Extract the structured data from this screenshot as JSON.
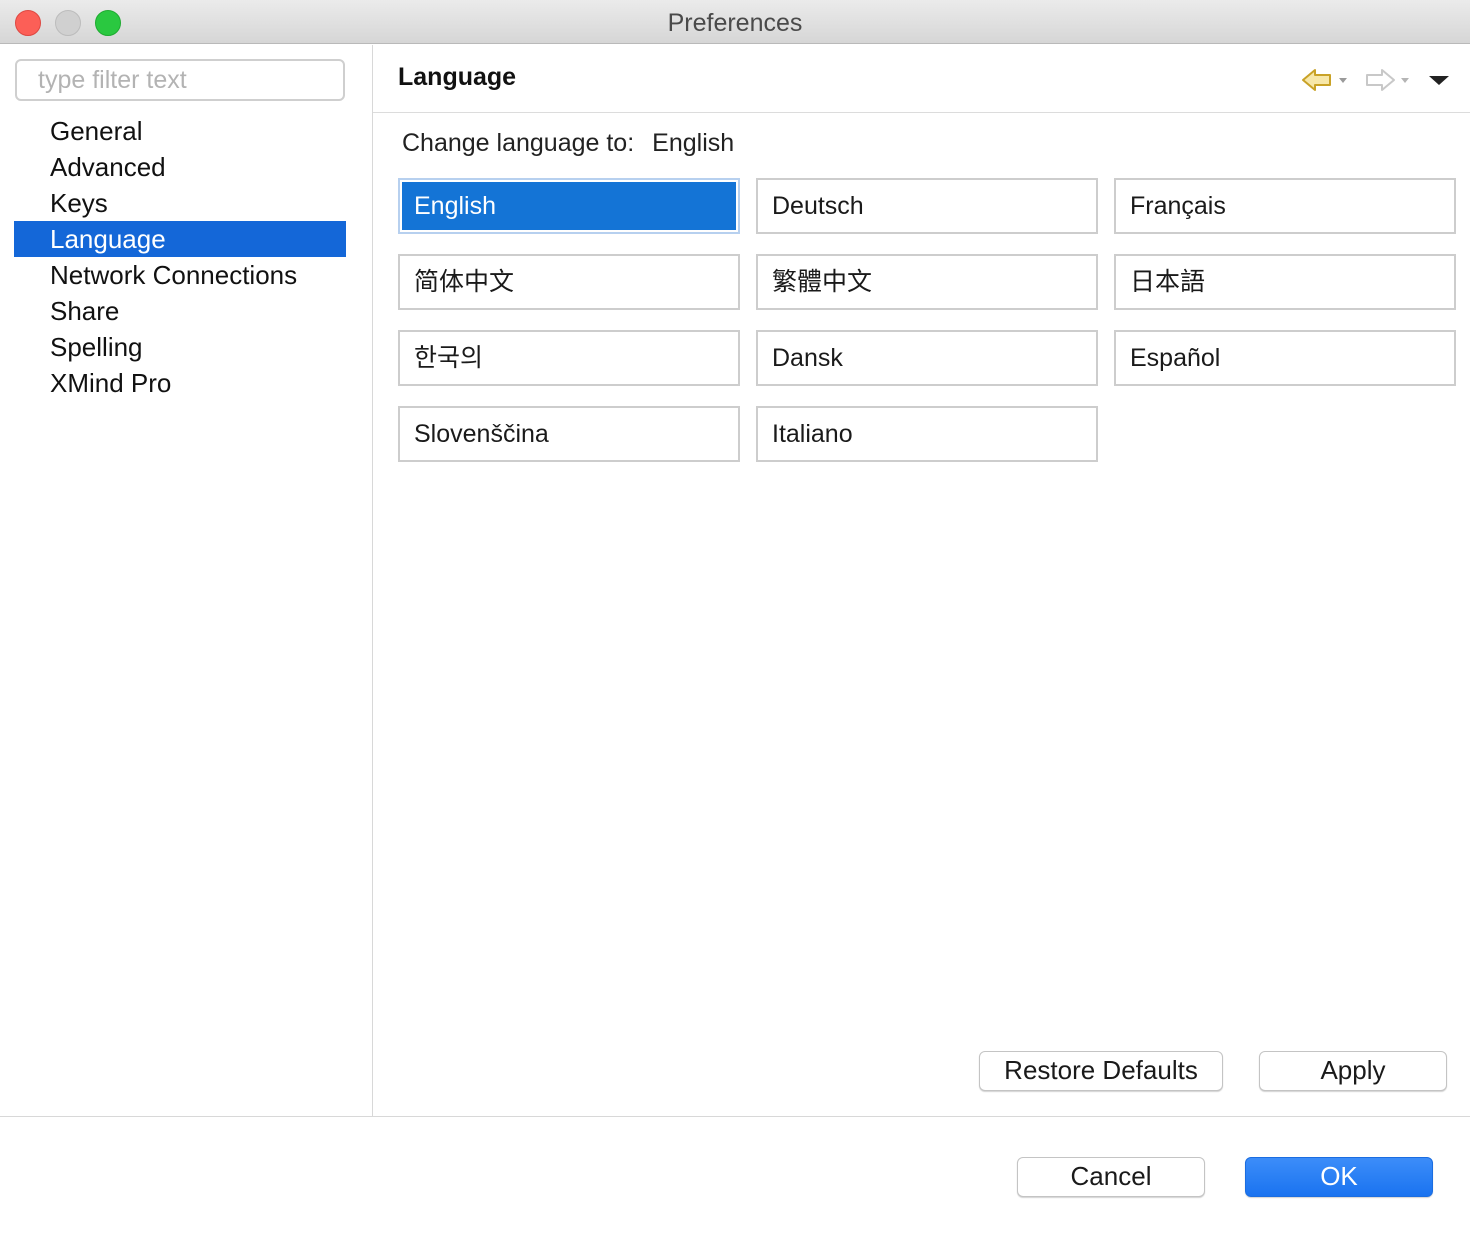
{
  "window": {
    "title": "Preferences"
  },
  "sidebar": {
    "filter_placeholder": "type filter text",
    "items": [
      {
        "label": "General"
      },
      {
        "label": "Advanced"
      },
      {
        "label": "Keys"
      },
      {
        "label": "Language",
        "selected": true
      },
      {
        "label": "Network Connections"
      },
      {
        "label": "Share"
      },
      {
        "label": "Spelling"
      },
      {
        "label": "XMind Pro"
      }
    ]
  },
  "page": {
    "title": "Language",
    "change_label": "Change language to:",
    "current_language": "English",
    "languages": [
      {
        "label": "English",
        "selected": true
      },
      {
        "label": "Deutsch"
      },
      {
        "label": "Français"
      },
      {
        "label": "简体中文"
      },
      {
        "label": "繁體中文"
      },
      {
        "label": "日本語"
      },
      {
        "label": "한국의"
      },
      {
        "label": "Dansk"
      },
      {
        "label": "Español"
      },
      {
        "label": "Slovenščina"
      },
      {
        "label": "Italiano"
      }
    ],
    "restore_defaults_label": "Restore Defaults",
    "apply_label": "Apply"
  },
  "footer": {
    "cancel_label": "Cancel",
    "ok_label": "OK"
  },
  "colors": {
    "accent": "#1467d8",
    "selected_button": "#1474d6",
    "ok_button": "#1a73f0",
    "back_arrow": "#c9a227"
  },
  "icons": {
    "back": "back-arrow-icon",
    "forward": "forward-arrow-icon",
    "view_menu": "view-menu-icon"
  }
}
